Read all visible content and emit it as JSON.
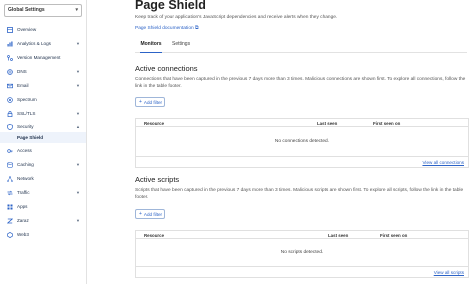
{
  "sidebar": {
    "account_selector": "Global Settings",
    "items": [
      {
        "label": "Overview",
        "icon": "overview-icon",
        "has_caret": false
      },
      {
        "label": "Analytics & Logs",
        "icon": "analytics-icon",
        "has_caret": true
      },
      {
        "label": "Version Management",
        "icon": "version-icon",
        "has_caret": false
      },
      {
        "label": "DNS",
        "icon": "dns-icon",
        "has_caret": true
      },
      {
        "label": "Email",
        "icon": "email-icon",
        "has_caret": true
      },
      {
        "label": "Spectrum",
        "icon": "spectrum-icon",
        "has_caret": false
      },
      {
        "label": "SSL/TLS",
        "icon": "lock-icon",
        "has_caret": true
      },
      {
        "label": "Security",
        "icon": "shield-icon",
        "has_caret": true
      },
      {
        "label": "Page Shield",
        "icon": "",
        "has_caret": false
      },
      {
        "label": "Access",
        "icon": "access-icon",
        "has_caret": false
      },
      {
        "label": "Caching",
        "icon": "caching-icon",
        "has_caret": true
      },
      {
        "label": "Network",
        "icon": "network-icon",
        "has_caret": false
      },
      {
        "label": "Traffic",
        "icon": "traffic-icon",
        "has_caret": true
      },
      {
        "label": "Apps",
        "icon": "apps-icon",
        "has_caret": false
      },
      {
        "label": "Zaraz",
        "icon": "zaraz-icon",
        "has_caret": true
      },
      {
        "label": "Web3",
        "icon": "web3-icon",
        "has_caret": false
      }
    ]
  },
  "header": {
    "title": "Page Shield",
    "description": "Keep track of your application's JavaScript dependencies and receive alerts when they change.",
    "doc_link": "Page Shield documentation ⧉"
  },
  "tabs": [
    {
      "label": "Monitors",
      "active": true
    },
    {
      "label": "Settings",
      "active": false
    }
  ],
  "connections": {
    "title": "Active connections",
    "description": "Connections that have been captured in the previous 7 days more than 3 times. Malicious connections are shown first. To explore all connections, follow the link in the table footer.",
    "add_filter": "Add filter",
    "columns": [
      "Resource",
      "Last seen",
      "First seen on"
    ],
    "empty": "No connections detected.",
    "footer_link": "View all connections"
  },
  "scripts": {
    "title": "Active scripts",
    "description": "Scripts that have been captured in the previous 7 days more than 3 times. Malicious scripts are shown first. To explore all scripts, follow the link in the table footer.",
    "add_filter": "Add filter",
    "columns": [
      "Resource",
      "Last seen",
      "First seen on"
    ],
    "empty": "No scripts detected.",
    "footer_link": "View all scripts"
  },
  "colors": {
    "accent": "#2c63c7",
    "sidebar_text": "#1d2f4a",
    "active_bg": "#eef3fb"
  }
}
